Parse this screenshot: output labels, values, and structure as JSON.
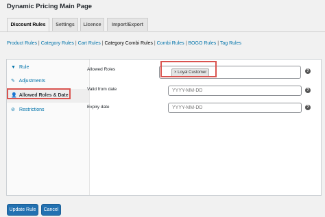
{
  "page": {
    "title": "Dynamic Pricing Main Page"
  },
  "tabs": [
    {
      "label": "Discount Rules",
      "active": true
    },
    {
      "label": "Settings",
      "active": false
    },
    {
      "label": "Licence",
      "active": false
    },
    {
      "label": "Import/Export",
      "active": false
    }
  ],
  "sublinks": [
    "Product Rules",
    "Category Rules",
    "Cart Rules",
    "Category Combi Rules",
    "Combi Rules",
    "BOGO Rules",
    "Tag Rules"
  ],
  "sublinks_current": "Category Combi Rules",
  "sidebar": {
    "items": [
      {
        "label": "Rule",
        "icon": "filter-icon"
      },
      {
        "label": "Adjustments",
        "icon": "wrench-icon"
      },
      {
        "label": "Allowed Roles & Date",
        "icon": "user-icon",
        "active": true
      },
      {
        "label": "Restrictions",
        "icon": "ban-icon"
      }
    ]
  },
  "form": {
    "allowed_roles_label": "Allowed Roles",
    "allowed_roles_chip": "× Loyal Customer",
    "valid_from_label": "Valid from date",
    "valid_from_placeholder": "YYYY-MM-DD",
    "expiry_label": "Expiry date",
    "expiry_placeholder": "YYYY-MM-DD",
    "help_glyph": "?"
  },
  "buttons": {
    "update": "Update Rule",
    "cancel": "Cancel"
  },
  "colors": {
    "accent": "#2271b1",
    "highlight": "#d9534f"
  }
}
